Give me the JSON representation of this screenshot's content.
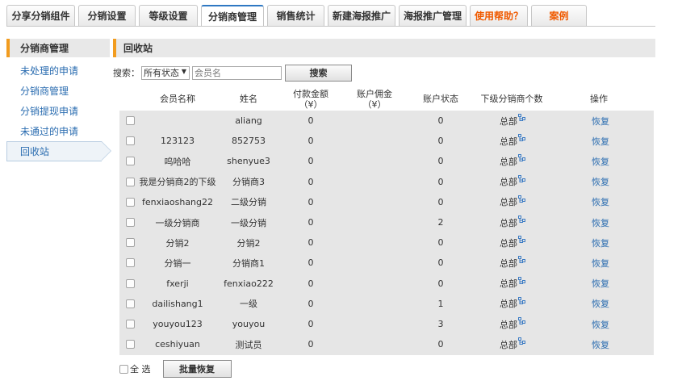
{
  "tabs": [
    {
      "label": "分享分销组件"
    },
    {
      "label": "分销设置"
    },
    {
      "label": "等级设置"
    },
    {
      "label": "分销商管理"
    },
    {
      "label": "销售统计"
    },
    {
      "label": "新建海报推广"
    },
    {
      "label": "海报推广管理"
    },
    {
      "label": "使用帮助？"
    },
    {
      "label": "案例"
    }
  ],
  "active_tab": "分销商管理",
  "sidebar": {
    "title": "分销商管理",
    "items": [
      {
        "label": "未处理的申请"
      },
      {
        "label": "分销商管理"
      },
      {
        "label": "分销提现申请"
      },
      {
        "label": "未通过的申请"
      },
      {
        "label": "回收站"
      }
    ],
    "active_item": "回收站"
  },
  "main": {
    "title": "回收站"
  },
  "search": {
    "label": "搜索：",
    "status_value": "所有状态",
    "member_placeholder": "会员名",
    "member_value": "",
    "button_label": "搜索"
  },
  "table": {
    "headers": {
      "member_name": "会员名称",
      "name": "姓名",
      "paid_amount_l1": "付款金额",
      "paid_amount_l2": "（¥）",
      "commission_l1": "账户佣金",
      "commission_l2": "（¥）",
      "account_status": "账户状态",
      "sub_count": "下级分销商个数",
      "actions": "操作"
    },
    "rows": [
      {
        "member": "",
        "name": "aliang",
        "paid": "0",
        "commission": "",
        "status": "0",
        "sub": "总部",
        "action": "恢复"
      },
      {
        "member": "123123",
        "name": "852753",
        "paid": "0",
        "commission": "",
        "status": "0",
        "sub": "总部",
        "action": "恢复"
      },
      {
        "member": "呜哈哈",
        "name": "shenyue3",
        "paid": "0",
        "commission": "",
        "status": "0",
        "sub": "总部",
        "action": "恢复"
      },
      {
        "member": "我是分销商2的下级",
        "name": "分销商3",
        "paid": "0",
        "commission": "",
        "status": "0",
        "sub": "总部",
        "action": "恢复"
      },
      {
        "member": "fenxiaoshang22",
        "name": "二级分销",
        "paid": "0",
        "commission": "",
        "status": "0",
        "sub": "总部",
        "action": "恢复"
      },
      {
        "member": "一级分销商",
        "name": "一级分销",
        "paid": "0",
        "commission": "",
        "status": "2",
        "sub": "总部",
        "action": "恢复"
      },
      {
        "member": "分销2",
        "name": "分销2",
        "paid": "0",
        "commission": "",
        "status": "0",
        "sub": "总部",
        "action": "恢复"
      },
      {
        "member": "分销一",
        "name": "分销商1",
        "paid": "0",
        "commission": "",
        "status": "0",
        "sub": "总部",
        "action": "恢复"
      },
      {
        "member": "fxerji",
        "name": "fenxiao222",
        "paid": "0",
        "commission": "",
        "status": "0",
        "sub": "总部",
        "action": "恢复"
      },
      {
        "member": "dailishang1",
        "name": "一级",
        "paid": "0",
        "commission": "",
        "status": "1",
        "sub": "总部",
        "action": "恢复"
      },
      {
        "member": "youyou123",
        "name": "youyou",
        "paid": "0",
        "commission": "",
        "status": "3",
        "sub": "总部",
        "action": "恢复"
      },
      {
        "member": "ceshiyuan",
        "name": "测试员",
        "paid": "0",
        "commission": "",
        "status": "0",
        "sub": "总部",
        "action": "恢复"
      }
    ]
  },
  "footer": {
    "select_all_label": "全 选",
    "batch_restore_label": "批量恢复"
  },
  "colors": {
    "accent_bar": "#f29c1f",
    "link": "#2a6cb0",
    "active_tab_border": "#2f78c3",
    "help_text": "#f05a00"
  },
  "icons": {
    "sub_distributor": "hierarchy-icon",
    "select_arrow": "dropdown-arrow-icon"
  }
}
